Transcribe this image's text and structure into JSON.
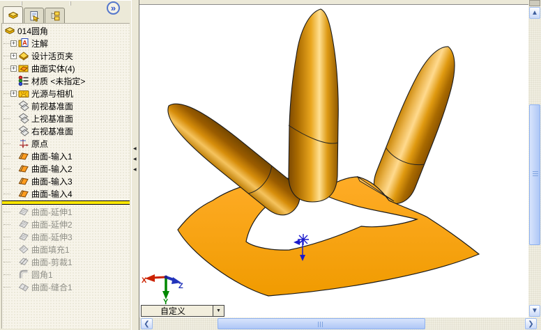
{
  "left_panel": {
    "tabs": [
      {
        "id": "featuremanager",
        "icon": "feature-tree-icon",
        "active": true
      },
      {
        "id": "propertymanager",
        "icon": "property-manager-icon",
        "active": false
      },
      {
        "id": "configurationmanager",
        "icon": "configuration-manager-icon",
        "active": false
      }
    ],
    "collapse_button": "»",
    "splitter_arrow": "◀",
    "tree": {
      "root": {
        "label": "014圆角",
        "icon": "part-icon"
      },
      "items": [
        {
          "label": "注解",
          "icon": "annotation-folder-icon",
          "expandable": true
        },
        {
          "label": "设计活页夹",
          "icon": "design-binder-icon",
          "expandable": true
        },
        {
          "label": "曲面实体(4)",
          "icon": "surface-bodies-folder-icon",
          "expandable": true
        },
        {
          "label": "材质 <未指定>",
          "icon": "material-icon",
          "expandable": false
        },
        {
          "label": "光源与相机",
          "icon": "lights-cameras-icon",
          "expandable": true
        },
        {
          "label": "前视基准面",
          "icon": "plane-icon",
          "expandable": false
        },
        {
          "label": "上视基准面",
          "icon": "plane-icon",
          "expandable": false
        },
        {
          "label": "右视基准面",
          "icon": "plane-icon",
          "expandable": false
        },
        {
          "label": "原点",
          "icon": "origin-icon",
          "expandable": false
        },
        {
          "label": "曲面-输入1",
          "icon": "surface-import-icon",
          "expandable": false
        },
        {
          "label": "曲面-输入2",
          "icon": "surface-import-icon",
          "expandable": false
        },
        {
          "label": "曲面-输入3",
          "icon": "surface-import-icon",
          "expandable": false
        },
        {
          "label": "曲面-输入4",
          "icon": "surface-import-icon",
          "expandable": false
        },
        {
          "rollback": true
        },
        {
          "label": "曲面-延伸1",
          "icon": "surface-extend-icon",
          "grayed": true
        },
        {
          "label": "曲面-延伸2",
          "icon": "surface-extend-icon",
          "grayed": true
        },
        {
          "label": "曲面-延伸3",
          "icon": "surface-extend-icon",
          "grayed": true
        },
        {
          "label": "曲面填充1",
          "icon": "surface-fill-icon",
          "grayed": true
        },
        {
          "label": "曲面-剪裁1",
          "icon": "surface-trim-icon",
          "grayed": true
        },
        {
          "label": "圆角1",
          "icon": "fillet-icon",
          "grayed": true
        },
        {
          "label": "曲面-缝合1",
          "icon": "surface-knit-icon",
          "grayed": true
        }
      ]
    }
  },
  "viewport": {
    "combo": {
      "value": "自定义"
    },
    "triad": {
      "x_label": "X",
      "y_label": "Y",
      "z_label": "Z"
    },
    "colors": {
      "surface_orange": "#F7A414",
      "wedge_highlight": "#FFC35A",
      "model_outline": "#1a1a1a",
      "rollback_yellow": "#ffe800",
      "origin_blue": "#1a1acc",
      "triad_x_red": "#cc2200",
      "triad_y_green": "#008800",
      "triad_z_blue": "#2233bb"
    }
  }
}
